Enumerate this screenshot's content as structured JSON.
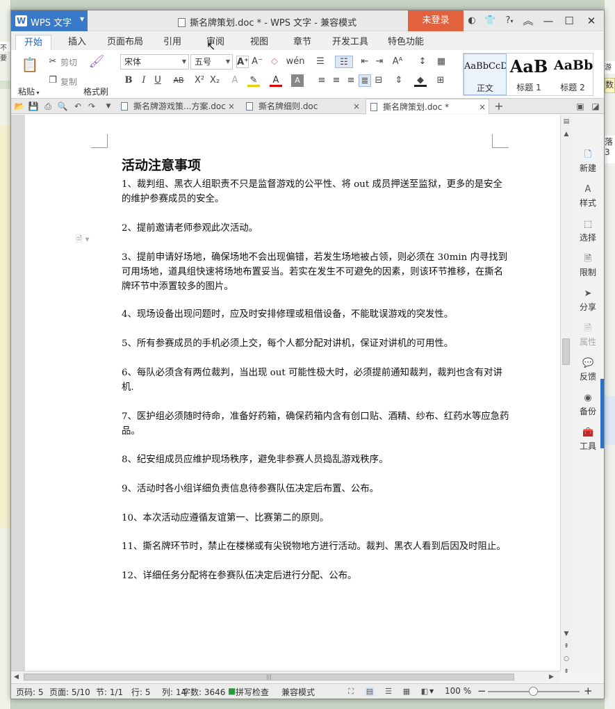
{
  "app": {
    "name": "WPS 文字",
    "window_title": "撕名牌策划.doc * - WPS 文字 - 兼容模式",
    "login_label": "未登录",
    "help_label": "?"
  },
  "background": {
    "left_strip_text": "不要",
    "right_text_1": "游戏",
    "right_text_2": "数",
    "right_text_3": "落 3"
  },
  "ribbon_tabs": [
    "开始",
    "插入",
    "页面布局",
    "引用",
    "审阅",
    "视图",
    "章节",
    "开发工具",
    "特色功能"
  ],
  "ribbon": {
    "paste_label": "粘贴",
    "cut_label": "剪切",
    "copy_label": "复制",
    "format_painter_label": "格式刷",
    "font_name": "宋体",
    "font_size": "五号",
    "styles": [
      {
        "sample": "AaBbCcD",
        "name": "正文"
      },
      {
        "sample": "AaB",
        "name": "标题 1"
      },
      {
        "sample": "AaBb(",
        "name": "标题 2"
      }
    ]
  },
  "doc_tabs": [
    {
      "label": "撕名牌游戏策...方案.doc"
    },
    {
      "label": "撕名牌细则.doc"
    },
    {
      "label": "撕名牌策划.doc *"
    }
  ],
  "document": {
    "heading": "活动注意事项",
    "paragraphs": [
      "1、裁判组、黑衣人组职责不只是监督游戏的公平性、将 out 成员押送至监狱，更多的是安全的维护参赛成员的安全。",
      "2、提前邀请老师参观此次活动。",
      "3、提前申请好场地，确保场地不会出现偏错，若发生场地被占领，则必须在 30min 内寻找到可用场地，道具组快速将场地布置妥当。若实在发生不可避免的因素，则该环节推移，在撕名牌环节中添置较多的图片。",
      "4、现场设备出现问题时，应及时安排修理或租借设备，不能耽误游戏的突发性。",
      "5、所有参赛成员的手机必须上交，每个人都分配对讲机，保证对讲机的可用性。",
      "6、每队必须含有两位裁判，当出现 out 可能性极大时，必须提前通知裁判，裁判也含有对讲机.",
      "7、医护组必须随时待命，准备好药箱，确保药箱内含有创口贴、酒精、纱布、红药水等应急药品。",
      "8、纪安组成员应维护现场秩序，避免非参赛人员捣乱游戏秩序。",
      "9、活动时各小组详细负责信息待参赛队伍决定后布置、公布。",
      "10、本次活动应遵循友谊第一、比赛第二的原则。",
      "11、撕名牌环节时，禁止在楼梯或有尖锐物地方进行活动。裁判、黑衣人看到后因及时阻止。",
      "12、详细任务分配将在参赛队伍决定后进行分配、公布。"
    ]
  },
  "task_pane": [
    "新建",
    "样式",
    "选择",
    "限制",
    "分享",
    "属性",
    "反馈",
    "备份",
    "工具"
  ],
  "status_bar": {
    "page_code": "页码: 5",
    "page": "页面: 5/10",
    "section": "节: 1/1",
    "row": "行: 5",
    "col": "列: 14",
    "word_count": "字数: 3646",
    "spell_check": "拼写检查",
    "compat_mode": "兼容模式",
    "zoom": "100 %"
  },
  "colors": {
    "app_blue": "#3a78c8",
    "login_orange": "#e2623f",
    "active_tab_text": "#1e5fbf"
  }
}
